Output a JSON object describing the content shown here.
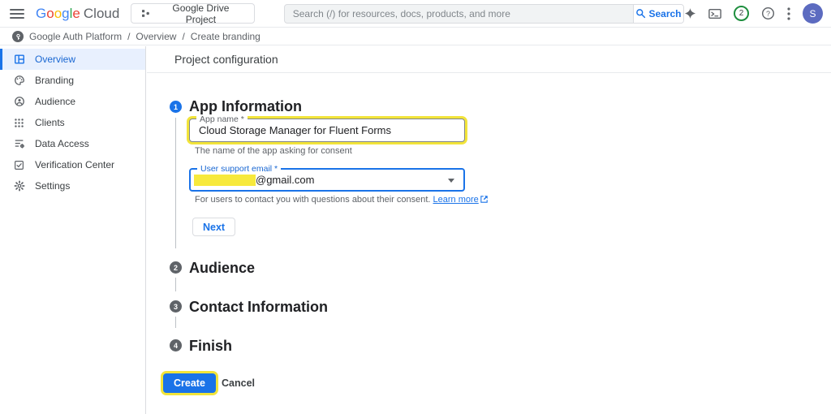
{
  "colors": {
    "accent_blue": "#1a73e8",
    "selected_item_bg": "#e8f0fe",
    "selected_item_text": "#1967d2",
    "highlight_yellow": "#f2e43a",
    "step_inactive_gray": "#5f6368",
    "avatar_bg": "#5c6bc0",
    "notification_ring_green": "#1e8e3e",
    "google_logo_letter_colors": [
      "#4285F4",
      "#EA4335",
      "#FBBC05",
      "#4285F4",
      "#34A853",
      "#EA4335"
    ]
  },
  "topbar": {
    "logo_letters": [
      "G",
      "o",
      "o",
      "g",
      "l",
      "e"
    ],
    "logo_suffix": "Cloud",
    "project_selector": "Google Drive Project",
    "search_placeholder": "Search (/) for resources, docs, products, and more",
    "search_button": "Search",
    "notification_count": "2",
    "avatar_initial": "S"
  },
  "breadcrumb": {
    "separator": "/",
    "items": [
      "Google Auth Platform",
      "Overview",
      "Create branding"
    ]
  },
  "sidebar": {
    "items": [
      {
        "label": "Overview",
        "selected": true
      },
      {
        "label": "Branding",
        "selected": false
      },
      {
        "label": "Audience",
        "selected": false
      },
      {
        "label": "Clients",
        "selected": false
      },
      {
        "label": "Data Access",
        "selected": false
      },
      {
        "label": "Verification Center",
        "selected": false
      },
      {
        "label": "Settings",
        "selected": false
      }
    ]
  },
  "main": {
    "title": "Project configuration",
    "steps": [
      {
        "num": "1",
        "title": "App Information"
      },
      {
        "num": "2",
        "title": "Audience"
      },
      {
        "num": "3",
        "title": "Contact Information"
      },
      {
        "num": "4",
        "title": "Finish"
      }
    ],
    "form": {
      "app_name": {
        "label": "App name *",
        "value": "Cloud Storage Manager for Fluent Forms",
        "helper": "The name of the app asking for consent"
      },
      "support_email": {
        "label": "User support email *",
        "value_suffix": "@gmail.com",
        "helper": "For users to contact you with questions about their consent.",
        "link": "Learn more"
      },
      "next_button": "Next"
    },
    "create_button": "Create",
    "cancel_button": "Cancel"
  }
}
